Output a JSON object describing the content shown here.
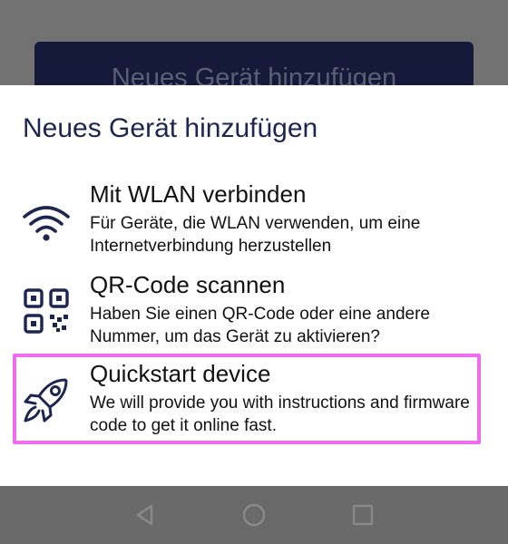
{
  "background": {
    "button_label": "Neues Gerät hinzufügen"
  },
  "sheet": {
    "title": "Neues Gerät hinzufügen",
    "options": [
      {
        "icon": "wifi-icon",
        "title": "Mit WLAN verbinden",
        "description": "Für Geräte, die WLAN verwenden, um eine Internetverbindung herzustellen"
      },
      {
        "icon": "qr-code-icon",
        "title": "QR-Code scannen",
        "description": "Haben Sie einen QR-Code oder eine andere Nummer, um das Gerät zu aktivieren?"
      },
      {
        "icon": "rocket-icon",
        "title": "Quickstart device",
        "description": "We will provide you with instructions and firmware code to get it online fast."
      }
    ]
  },
  "colors": {
    "title": "#1d2550",
    "highlight": "#f06cf0",
    "bg_button": "#15193a"
  },
  "navbar": {
    "icons": [
      "back-triangle-icon",
      "home-circle-icon",
      "recents-square-icon"
    ]
  }
}
